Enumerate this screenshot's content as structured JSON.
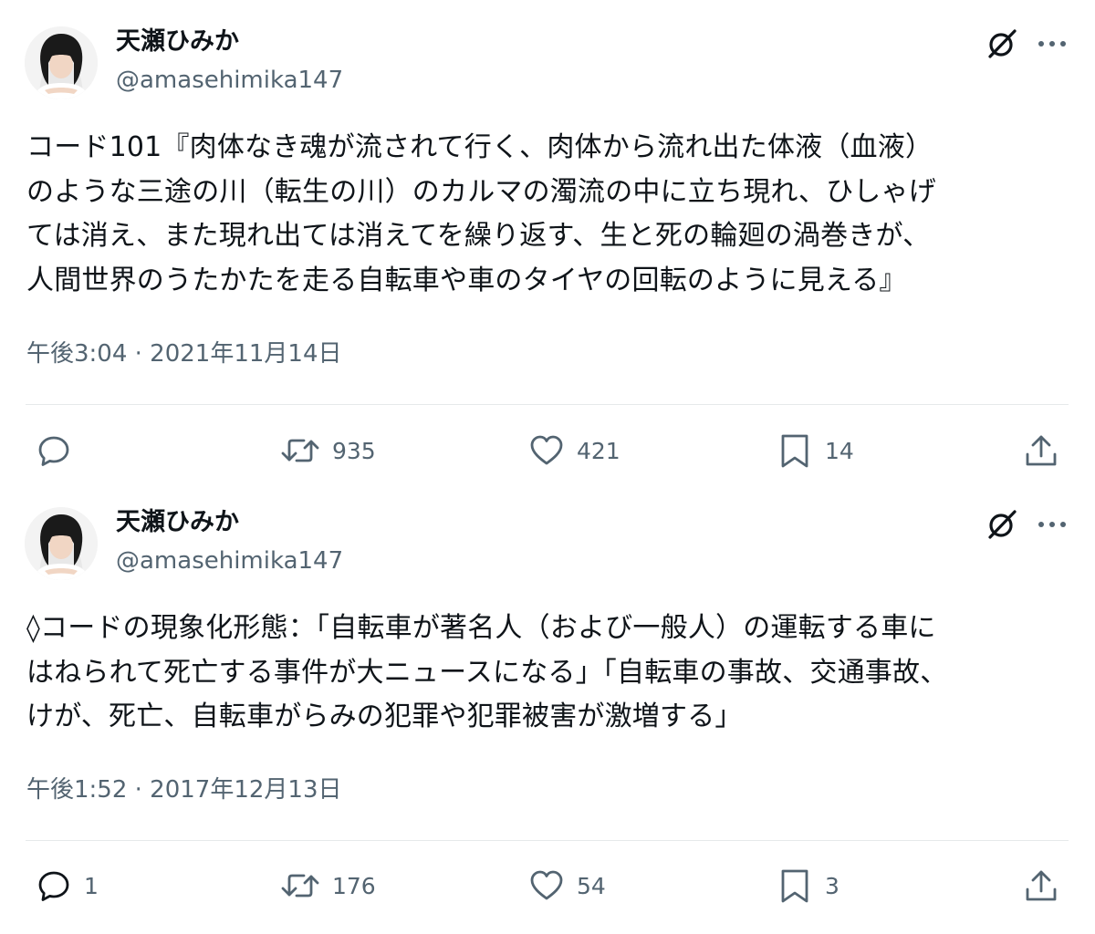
{
  "tweets": [
    {
      "author": {
        "display_name": "天瀬ひみか",
        "handle": "@amasehimika147"
      },
      "text_lines": [
        "コード101『肉体なき魂が流されて行く、肉体から流れ出た体液（血液）",
        "のような三途の川（転生の川）のカルマの濁流の中に立ち現れ、ひしゃげ",
        "ては消え、また現れ出ては消えてを繰り返す、生と死の輪廻の渦巻きが、",
        "人間世界のうたかたを走る自転車や車のタイヤの回転のように見える』"
      ],
      "timestamp": "午後3:04 · 2021年11月14日",
      "stats": {
        "replies": "",
        "retweets": "935",
        "likes": "421",
        "bookmarks": "14"
      }
    },
    {
      "author": {
        "display_name": "天瀬ひみか",
        "handle": "@amasehimika147"
      },
      "text_lines": [
        "◊コードの現象化形態：「自転車が著名人（および一般人）の運転する車に",
        "はねられて死亡する事件が大ニュースになる」「自転車の事故、交通事故、",
        "けが、死亡、自転車がらみの犯罪や犯罪被害が激増する」"
      ],
      "timestamp": "午後1:52 · 2017年12月13日",
      "stats": {
        "replies": "1",
        "retweets": "176",
        "likes": "54",
        "bookmarks": "3"
      }
    }
  ],
  "icons": {
    "avatar": "avatar-photo",
    "grok": "grok-icon",
    "more": "more-icon",
    "reply": "reply-icon",
    "retweet": "retweet-icon",
    "like": "heart-icon",
    "bookmark": "bookmark-icon",
    "share": "share-icon"
  },
  "colors": {
    "text_primary": "#0f1419",
    "text_secondary": "#536471",
    "divider": "#e6e9ea"
  }
}
